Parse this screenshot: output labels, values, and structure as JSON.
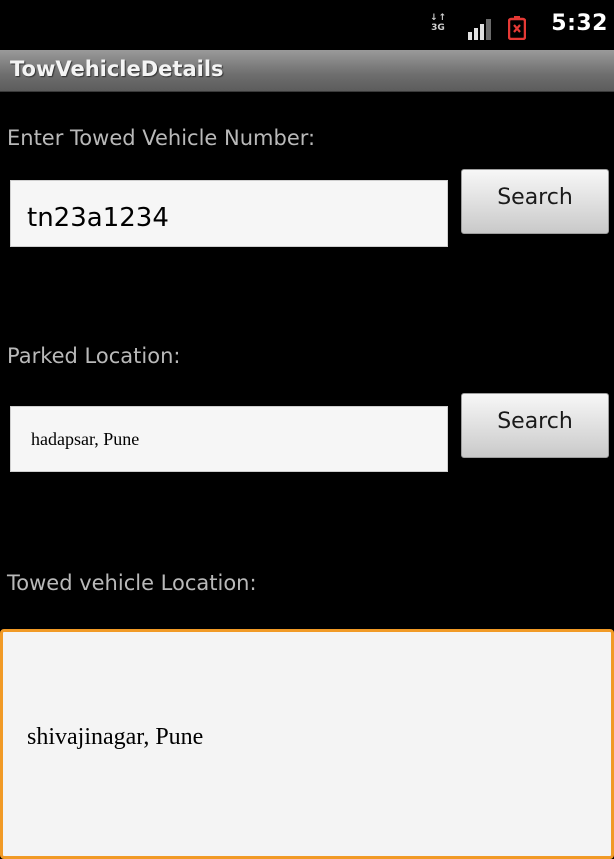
{
  "status_bar": {
    "network_label": "3G",
    "network_arrows": "↓↑",
    "time": "5:32",
    "icons": [
      "network-3g-icon",
      "signal-strength-icon",
      "battery-low-icon"
    ],
    "battery_color": "#e53935"
  },
  "title_bar": {
    "title": "TowVehicleDetails"
  },
  "form": {
    "vehicle_number_label": "Enter Towed Vehicle Number:",
    "vehicle_number_value": "tn23a1234",
    "search_vehicle_label": "Search",
    "parked_location_label": "Parked Location:",
    "parked_location_value": "hadapsar, Pune",
    "search_location_label": "Search",
    "towed_location_label": "Towed vehicle Location:",
    "towed_location_value": "shivajinagar, Pune"
  },
  "colors": {
    "background": "#000000",
    "focus_border": "#f19a26",
    "field_background": "#f6f6f6"
  }
}
